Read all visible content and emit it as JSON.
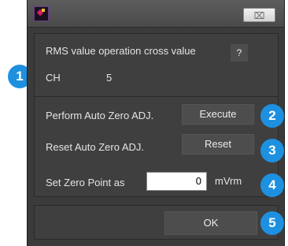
{
  "titlebar": {
    "close_label": "⌧"
  },
  "rows": {
    "title": "RMS value operation cross value",
    "help_label": "?",
    "ch_label": "CH",
    "ch_value": "5",
    "perform_label": "Perform Auto Zero ADJ.",
    "execute_label": "Execute",
    "reset_row_label": "Reset Auto Zero ADJ.",
    "reset_label": "Reset",
    "zero_point_label": "Set Zero Point as",
    "zero_point_value": "0",
    "unit": "mVrm"
  },
  "footer": {
    "ok_label": "OK"
  },
  "badges": [
    "1",
    "2",
    "3",
    "4",
    "5"
  ],
  "colors": {
    "badge": "#1e90e0",
    "background": "#3b3b3b"
  }
}
